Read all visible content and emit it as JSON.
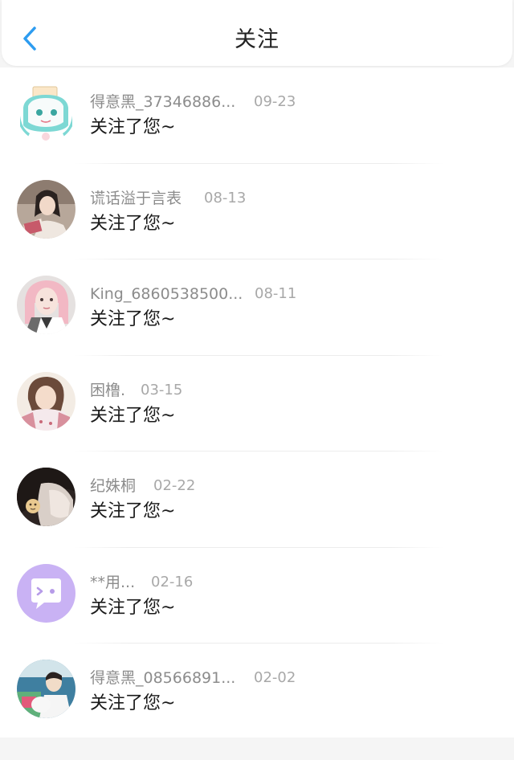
{
  "header": {
    "title": "关注",
    "back_icon": "chevron-left-icon",
    "accent": "#2d9cf0"
  },
  "items": [
    {
      "name": "得意黑_37346886...",
      "date": "09-23",
      "action": "关注了您~",
      "avatar": "cartoon-avatar"
    },
    {
      "name": "谎话溢于言表",
      "date": "08-13",
      "action": "关注了您~",
      "avatar": "photo-avatar"
    },
    {
      "name": "King_6860538500...",
      "date": "08-11",
      "action": "关注了您~",
      "avatar": "photo-avatar"
    },
    {
      "name": "困橹.",
      "date": "03-15",
      "action": "关注了您~",
      "avatar": "photo-avatar"
    },
    {
      "name": "纪姝桐",
      "date": "02-22",
      "action": "关注了您~",
      "avatar": "photo-avatar"
    },
    {
      "name": "**用...",
      "date": "02-16",
      "action": "关注了您~",
      "avatar": "chat-bubble-icon"
    },
    {
      "name": "得意黑_08566891...",
      "date": "02-02",
      "action": "关注了您~",
      "avatar": "photo-avatar"
    }
  ]
}
